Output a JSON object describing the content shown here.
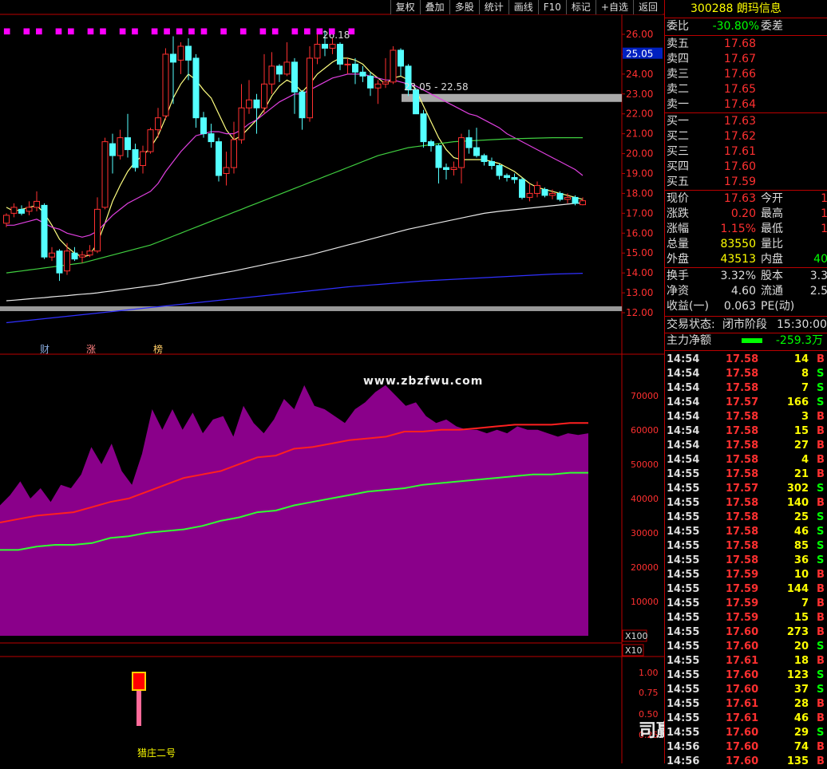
{
  "toolbar": [
    "复权",
    "叠加",
    "多股",
    "统计",
    "画线",
    "F10",
    "标记",
    "+自选",
    "返回"
  ],
  "stock": {
    "code": "300288",
    "name": "朗玛信息"
  },
  "price_axis": [
    "26.00",
    "25.00",
    "24.00",
    "23.00",
    "22.00",
    "21.00",
    "20.00",
    "19.00",
    "18.00",
    "17.00",
    "16.00",
    "15.00",
    "14.00",
    "13.00",
    "12.00"
  ],
  "price_tag": "25.05",
  "annotations": {
    "high": "26.18",
    "range": "23.05 - 22.58"
  },
  "event_labels": [
    "财",
    "涨",
    "榜"
  ],
  "vol_axis": [
    "70000",
    "60000",
    "50000",
    "40000",
    "30000",
    "20000",
    "10000"
  ],
  "vol_unit": "X100",
  "ind_unit": "X10",
  "ind_axis": [
    "1.00",
    "0.75",
    "0.50",
    "0.25"
  ],
  "ind_label": "猎庄二号",
  "watermark": "www.zbzfwu.com",
  "watermark2": "司赢空指标所",
  "quote": {
    "weibi_label": "委比",
    "weibi": "-30.80%",
    "weicha_label": "委差",
    "sells": [
      {
        "l": "卖五",
        "p": "17.68"
      },
      {
        "l": "卖四",
        "p": "17.67"
      },
      {
        "l": "卖三",
        "p": "17.66"
      },
      {
        "l": "卖二",
        "p": "17.65"
      },
      {
        "l": "卖一",
        "p": "17.64"
      }
    ],
    "buys": [
      {
        "l": "买一",
        "p": "17.63"
      },
      {
        "l": "买二",
        "p": "17.62"
      },
      {
        "l": "买三",
        "p": "17.61"
      },
      {
        "l": "买四",
        "p": "17.60"
      },
      {
        "l": "买五",
        "p": "17.59"
      }
    ],
    "stats": [
      {
        "l": "现价",
        "v": "17.63",
        "l2": "今开",
        "v2": "1"
      },
      {
        "l": "涨跌",
        "v": "0.20",
        "l2": "最高",
        "v2": "1"
      },
      {
        "l": "涨幅",
        "v": "1.15%",
        "l2": "最低",
        "v2": "1"
      },
      {
        "l": "总量",
        "v": "83550",
        "l2": "量比",
        "v2": ""
      },
      {
        "l": "外盘",
        "v": "43513",
        "l2": "内盘",
        "v2": "40"
      }
    ],
    "stats2": [
      {
        "l": "换手",
        "v": "3.32%",
        "l2": "股本",
        "v2": "3.3"
      },
      {
        "l": "净资",
        "v": "4.60",
        "l2": "流通",
        "v2": "2.5"
      },
      {
        "l": "收益(一)",
        "v": "0.063",
        "l2": "PE(动)",
        "v2": ""
      }
    ],
    "status_label": "交易状态:",
    "status": "闭市阶段",
    "time": "15:30:00",
    "mainflow_label": "主力净额",
    "mainflow": "-259.3万"
  },
  "trades": [
    [
      "14:54",
      "17.58",
      "14",
      "B"
    ],
    [
      "14:54",
      "17.58",
      "8",
      "S"
    ],
    [
      "14:54",
      "17.58",
      "7",
      "S"
    ],
    [
      "14:54",
      "17.57",
      "166",
      "S"
    ],
    [
      "14:54",
      "17.58",
      "3",
      "B"
    ],
    [
      "14:54",
      "17.58",
      "15",
      "B"
    ],
    [
      "14:54",
      "17.58",
      "27",
      "B"
    ],
    [
      "14:54",
      "17.58",
      "4",
      "B"
    ],
    [
      "14:55",
      "17.58",
      "21",
      "B"
    ],
    [
      "14:55",
      "17.57",
      "302",
      "S"
    ],
    [
      "14:55",
      "17.58",
      "140",
      "B"
    ],
    [
      "14:55",
      "17.58",
      "25",
      "S"
    ],
    [
      "14:55",
      "17.58",
      "46",
      "S"
    ],
    [
      "14:55",
      "17.58",
      "85",
      "S"
    ],
    [
      "14:55",
      "17.58",
      "36",
      "S"
    ],
    [
      "14:55",
      "17.59",
      "10",
      "B"
    ],
    [
      "14:55",
      "17.59",
      "144",
      "B"
    ],
    [
      "14:55",
      "17.59",
      "7",
      "B"
    ],
    [
      "14:55",
      "17.59",
      "15",
      "B"
    ],
    [
      "14:55",
      "17.60",
      "273",
      "B"
    ],
    [
      "14:55",
      "17.60",
      "20",
      "S"
    ],
    [
      "14:55",
      "17.61",
      "18",
      "B"
    ],
    [
      "14:55",
      "17.60",
      "123",
      "S"
    ],
    [
      "14:55",
      "17.60",
      "37",
      "S"
    ],
    [
      "14:55",
      "17.61",
      "28",
      "B"
    ],
    [
      "14:55",
      "17.61",
      "46",
      "B"
    ],
    [
      "14:55",
      "17.60",
      "29",
      "S"
    ],
    [
      "14:56",
      "17.60",
      "74",
      "B"
    ],
    [
      "14:56",
      "17.60",
      "135",
      "B"
    ]
  ],
  "chart_data": {
    "type": "candlestick",
    "y_range": [
      12,
      26.2
    ],
    "candles": [
      [
        16.5,
        16.9,
        16.3,
        17.0
      ],
      [
        17.0,
        17.3,
        16.8,
        17.5
      ],
      [
        17.2,
        17.0,
        16.9,
        17.4
      ],
      [
        17.1,
        17.3,
        16.9,
        17.6
      ],
      [
        17.3,
        17.6,
        17.1,
        18.1
      ],
      [
        17.4,
        14.8,
        14.7,
        17.5
      ],
      [
        14.8,
        15.0,
        14.6,
        15.3
      ],
      [
        15.1,
        14.0,
        13.6,
        15.2
      ],
      [
        14.1,
        15.1,
        13.9,
        15.5
      ],
      [
        15.0,
        14.7,
        14.6,
        15.3
      ],
      [
        14.8,
        14.9,
        14.5,
        15.1
      ],
      [
        14.9,
        15.1,
        14.8,
        15.4
      ],
      [
        15.1,
        17.2,
        15.0,
        17.8
      ],
      [
        17.3,
        20.6,
        17.2,
        20.8
      ],
      [
        20.5,
        19.9,
        19.0,
        21.0
      ],
      [
        19.9,
        20.8,
        19.7,
        21.2
      ],
      [
        20.8,
        20.2,
        19.8,
        22.0
      ],
      [
        20.2,
        19.3,
        19.1,
        20.5
      ],
      [
        19.4,
        20.1,
        19.0,
        20.4
      ],
      [
        20.1,
        21.2,
        20.0,
        21.3
      ],
      [
        21.2,
        21.8,
        20.8,
        22.3
      ],
      [
        21.9,
        25.0,
        21.7,
        25.3
      ],
      [
        25.0,
        24.6,
        22.5,
        25.9
      ],
      [
        24.7,
        25.4,
        24.0,
        25.6
      ],
      [
        25.4,
        24.7,
        23.7,
        25.8
      ],
      [
        24.8,
        21.8,
        21.3,
        25.0
      ],
      [
        21.8,
        21.0,
        20.8,
        22.1
      ],
      [
        21.0,
        20.6,
        20.3,
        21.5
      ],
      [
        20.6,
        18.9,
        18.6,
        20.8
      ],
      [
        19.0,
        19.3,
        18.4,
        20.1
      ],
      [
        19.3,
        20.7,
        19.0,
        21.6
      ],
      [
        20.7,
        22.3,
        20.5,
        23.5
      ],
      [
        22.3,
        22.7,
        22.0,
        23.7
      ],
      [
        22.7,
        22.3,
        21.0,
        23.0
      ],
      [
        22.3,
        23.5,
        22.0,
        25.0
      ],
      [
        23.5,
        24.4,
        23.0,
        25.1
      ],
      [
        24.4,
        24.0,
        23.6,
        24.5
      ],
      [
        24.0,
        24.6,
        23.9,
        25.6
      ],
      [
        24.6,
        23.1,
        22.0,
        24.8
      ],
      [
        23.1,
        21.8,
        21.2,
        23.2
      ],
      [
        21.8,
        24.8,
        21.6,
        25.4
      ],
      [
        24.8,
        25.5,
        24.5,
        26.0
      ],
      [
        25.5,
        25.3,
        24.9,
        26.2
      ],
      [
        25.3,
        25.5,
        25.0,
        25.8
      ],
      [
        25.5,
        24.5,
        24.2,
        25.6
      ],
      [
        24.5,
        24.5,
        24.0,
        24.8
      ],
      [
        24.5,
        24.1,
        23.5,
        24.8
      ],
      [
        24.1,
        23.9,
        23.6,
        24.4
      ],
      [
        23.9,
        23.3,
        22.9,
        24.1
      ],
      [
        23.3,
        23.5,
        22.5,
        23.7
      ],
      [
        23.5,
        23.6,
        23.3,
        24.8
      ],
      [
        23.6,
        25.2,
        23.5,
        25.4
      ],
      [
        25.2,
        24.4,
        23.9,
        25.3
      ],
      [
        24.4,
        23.2,
        22.9,
        24.5
      ],
      [
        23.2,
        22.0,
        22.6,
        23.3
      ],
      [
        22.0,
        20.6,
        20.3,
        22.2
      ],
      [
        20.6,
        20.4,
        20.1,
        20.7
      ],
      [
        20.4,
        19.3,
        18.5,
        20.5
      ],
      [
        19.3,
        19.2,
        18.7,
        19.5
      ],
      [
        19.2,
        19.3,
        18.9,
        19.6
      ],
      [
        19.3,
        20.8,
        18.5,
        21.0
      ],
      [
        20.8,
        20.3,
        20.0,
        21.2
      ],
      [
        20.3,
        19.9,
        19.8,
        21.3
      ],
      [
        19.9,
        19.6,
        19.4,
        20.0
      ],
      [
        19.6,
        19.4,
        19.2,
        19.8
      ],
      [
        19.4,
        18.9,
        18.7,
        19.5
      ],
      [
        18.9,
        18.8,
        18.6,
        19.0
      ],
      [
        18.8,
        18.7,
        18.5,
        19.0
      ],
      [
        18.7,
        17.8,
        17.7,
        18.8
      ],
      [
        17.8,
        18.0,
        17.6,
        18.5
      ],
      [
        18.0,
        18.4,
        17.8,
        18.6
      ],
      [
        18.2,
        17.9,
        17.8,
        18.3
      ],
      [
        17.9,
        18.0,
        17.7,
        18.2
      ],
      [
        18.0,
        17.7,
        17.6,
        18.1
      ],
      [
        17.7,
        17.8,
        17.5,
        18.0
      ],
      [
        17.8,
        17.5,
        17.4,
        17.9
      ],
      [
        17.43,
        17.63,
        17.4,
        17.8
      ]
    ],
    "ma_lines": [
      {
        "color": "#ffff80",
        "values": [
          17.3,
          17.1,
          17.2,
          17.3,
          17.4,
          17.0,
          16.4,
          15.7,
          15.3,
          15.0,
          14.8,
          14.9,
          15.5,
          16.5,
          17.6,
          18.4,
          19.1,
          19.6,
          19.9,
          20.3,
          20.9,
          21.8,
          22.8,
          23.5,
          24.0,
          23.7,
          23.2,
          22.8,
          22.0,
          21.2,
          20.7,
          20.9,
          21.3,
          21.7,
          22.2,
          22.9,
          23.4,
          23.7,
          23.5,
          23.1,
          23.5,
          24.0,
          24.3,
          24.6,
          24.8,
          24.8,
          24.7,
          24.5,
          24.1,
          23.8,
          23.5,
          23.8,
          23.9,
          23.7,
          23.2,
          22.4,
          21.6,
          20.8,
          20.2,
          19.8,
          19.7,
          19.7,
          19.7,
          19.7,
          19.6,
          19.5,
          19.3,
          19.1,
          18.8,
          18.5,
          18.3,
          18.2,
          18.1,
          18.0,
          17.9,
          17.8,
          17.7
        ]
      },
      {
        "color": "#e040e0",
        "values": [
          16.4,
          16.4,
          16.5,
          16.6,
          16.7,
          16.5,
          16.3,
          16.2,
          16.0,
          15.9,
          15.8,
          15.9,
          16.1,
          16.5,
          16.9,
          17.2,
          17.5,
          17.7,
          17.9,
          18.1,
          18.5,
          19.1,
          19.6,
          20.1,
          20.5,
          20.9,
          21.0,
          21.1,
          21.1,
          21.0,
          21.0,
          21.2,
          21.5,
          21.7,
          22.0,
          22.3,
          22.6,
          22.8,
          23.0,
          23.0,
          23.2,
          23.4,
          23.6,
          23.8,
          23.9,
          24.0,
          24.0,
          24.0,
          23.9,
          23.8,
          23.7,
          23.7,
          23.6,
          23.5,
          23.4,
          23.2,
          23.0,
          22.8,
          22.6,
          22.4,
          22.2,
          22.0,
          21.9,
          21.7,
          21.5,
          21.3,
          21.0,
          20.8,
          20.6,
          20.4,
          20.2,
          20.0,
          19.8,
          19.6,
          19.4,
          19.2,
          18.9
        ]
      },
      {
        "color": "#40d040",
        "values": [
          14.0,
          14.05,
          14.1,
          14.15,
          14.2,
          14.25,
          14.3,
          14.35,
          14.4,
          14.45,
          14.5,
          14.6,
          14.7,
          14.8,
          14.9,
          15.0,
          15.1,
          15.2,
          15.3,
          15.4,
          15.55,
          15.7,
          15.85,
          16.0,
          16.15,
          16.3,
          16.45,
          16.6,
          16.75,
          16.9,
          17.05,
          17.2,
          17.35,
          17.5,
          17.65,
          17.8,
          17.95,
          18.1,
          18.25,
          18.4,
          18.55,
          18.7,
          18.85,
          19.0,
          19.15,
          19.3,
          19.45,
          19.6,
          19.75,
          19.9,
          20.0,
          20.1,
          20.2,
          20.3,
          20.35,
          20.4,
          20.45,
          20.5,
          20.55,
          20.6,
          20.62,
          20.64,
          20.66,
          20.68,
          20.7,
          20.72,
          20.74,
          20.75,
          20.76,
          20.77,
          20.78,
          20.79,
          20.8,
          20.8,
          20.8,
          20.8,
          20.8
        ]
      },
      {
        "color": "#e8e8e8",
        "values": [
          12.6,
          12.63,
          12.66,
          12.7,
          12.73,
          12.76,
          12.8,
          12.83,
          12.86,
          12.9,
          12.93,
          12.96,
          13.0,
          13.05,
          13.1,
          13.15,
          13.2,
          13.25,
          13.3,
          13.35,
          13.4,
          13.47,
          13.54,
          13.61,
          13.68,
          13.75,
          13.82,
          13.89,
          13.96,
          14.03,
          14.1,
          14.18,
          14.26,
          14.34,
          14.42,
          14.5,
          14.58,
          14.66,
          14.74,
          14.82,
          14.9,
          15.0,
          15.1,
          15.2,
          15.3,
          15.4,
          15.5,
          15.6,
          15.7,
          15.8,
          15.9,
          16.0,
          16.1,
          16.2,
          16.28,
          16.36,
          16.44,
          16.52,
          16.6,
          16.68,
          16.76,
          16.84,
          16.92,
          17.0,
          17.05,
          17.1,
          17.14,
          17.18,
          17.22,
          17.26,
          17.3,
          17.34,
          17.38,
          17.42,
          17.46,
          17.5,
          17.52
        ]
      },
      {
        "color": "#3030ff",
        "values": [
          11.5,
          11.54,
          11.58,
          11.62,
          11.66,
          11.7,
          11.74,
          11.78,
          11.82,
          11.86,
          11.9,
          11.94,
          11.98,
          12.02,
          12.06,
          12.1,
          12.14,
          12.18,
          12.22,
          12.26,
          12.3,
          12.34,
          12.38,
          12.42,
          12.46,
          12.5,
          12.54,
          12.58,
          12.62,
          12.66,
          12.7,
          12.74,
          12.78,
          12.82,
          12.86,
          12.9,
          12.94,
          12.98,
          13.02,
          13.06,
          13.1,
          13.14,
          13.18,
          13.22,
          13.26,
          13.3,
          13.33,
          13.36,
          13.39,
          13.42,
          13.45,
          13.48,
          13.51,
          13.54,
          13.57,
          13.6,
          13.62,
          13.64,
          13.66,
          13.68,
          13.7,
          13.72,
          13.74,
          13.76,
          13.78,
          13.8,
          13.82,
          13.84,
          13.86,
          13.88,
          13.9,
          13.92,
          13.94,
          13.95,
          13.96,
          13.97,
          13.98
        ]
      }
    ],
    "vol_range": [
      0,
      76000
    ],
    "vol_area": [
      38000,
      41000,
      45000,
      40000,
      43000,
      39000,
      44000,
      43000,
      47000,
      55000,
      50000,
      56000,
      48000,
      44000,
      53000,
      66000,
      60000,
      66000,
      60000,
      65000,
      59000,
      63000,
      64000,
      58000,
      67000,
      62000,
      59000,
      63000,
      69000,
      66000,
      73000,
      67000,
      66000,
      64000,
      62000,
      66000,
      68000,
      71000,
      73000,
      70000,
      67000,
      68000,
      64000,
      62000,
      63000,
      61000,
      60000,
      60000,
      59000,
      60000,
      59000,
      61000,
      60000,
      60000,
      59000,
      58000,
      59000,
      58500,
      59000
    ],
    "vol_red": [
      33000,
      34000,
      35000,
      35500,
      36000,
      37500,
      39000,
      40000,
      42000,
      44000,
      46000,
      47000,
      48000,
      50000,
      52000,
      52500,
      54500,
      55000,
      56000,
      57000,
      57500,
      58000,
      59500,
      59500,
      60000,
      60000,
      60500,
      61000,
      61500,
      61500,
      61500,
      62000,
      62000
    ],
    "vol_green": [
      25000,
      25000,
      26000,
      26500,
      26500,
      27000,
      28500,
      29000,
      30000,
      30500,
      31000,
      32000,
      33500,
      34500,
      36000,
      36500,
      38000,
      39000,
      40000,
      41000,
      42000,
      42500,
      43000,
      44000,
      44500,
      45000,
      45500,
      46000,
      46500,
      47000,
      47000,
      47500,
      47500
    ],
    "ind_range": [
      0,
      1.2
    ],
    "ind_bar": {
      "index": 17,
      "value": 1.0
    }
  }
}
